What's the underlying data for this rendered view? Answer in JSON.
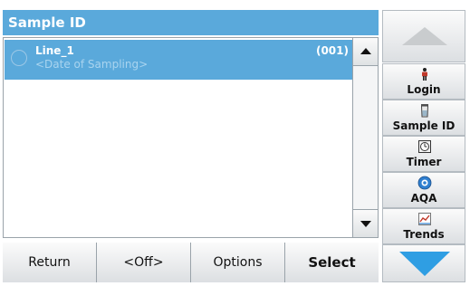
{
  "window": {
    "title": "Sample ID"
  },
  "list": {
    "items": [
      {
        "name": "Line_1",
        "subtitle": "<Date of Sampling>",
        "count": "(001)",
        "selected": true
      }
    ]
  },
  "bottom_bar": {
    "buttons": [
      "Return",
      "<Off>",
      "Options",
      "Select"
    ]
  },
  "sidebar": {
    "items": [
      {
        "label": "Login",
        "icon": "login-person-icon"
      },
      {
        "label": "Sample ID",
        "icon": "sample-id-icon"
      },
      {
        "label": "Timer",
        "icon": "timer-icon"
      },
      {
        "label": "AQA",
        "icon": "aqa-icon"
      },
      {
        "label": "Trends",
        "icon": "trends-icon"
      }
    ]
  },
  "colors": {
    "accent": "#5aa9db",
    "nav_down_arrow": "#2f9ee3",
    "nav_up_arrow": "#c9ccce"
  }
}
